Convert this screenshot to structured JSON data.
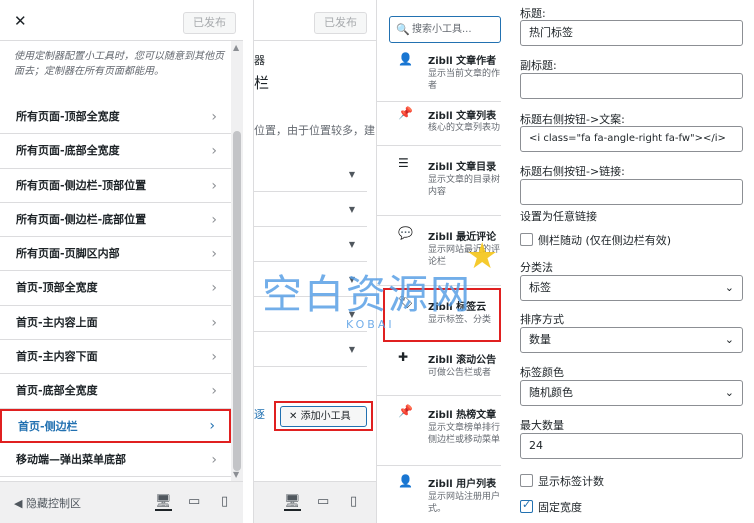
{
  "panel1": {
    "publish": "已发布",
    "description": "使用定制器配置小工具时，您可以随意到其他页面去；定制器在所有页面都能用。",
    "areas": [
      "所有页面-顶部全宽度",
      "所有页面-底部全宽度",
      "所有页面-侧边栏-顶部位置",
      "所有页面-侧边栏-底部位置",
      "所有页面-页脚区内部",
      "首页-顶部全宽度",
      "首页-主内容上面",
      "首页-主内容下面",
      "首页-底部全宽度",
      "首页-侧边栏",
      "移动端—弹出菜单底部"
    ],
    "footer": "隐藏控制区"
  },
  "panel2": {
    "publish": "已发布",
    "snip1": "器",
    "snip2": "栏",
    "snip3": "位置，由于位置较多，建",
    "snip4": "逐",
    "add": "添加小工具"
  },
  "panel3": {
    "search_placeholder": "搜索小工具...",
    "widgets": [
      {
        "t": "Zibll 文章作者",
        "d": "显示当前文章的作者"
      },
      {
        "t": "Zibll 文章列表",
        "d": "核心的文章列表功"
      },
      {
        "t": "Zibll 文章目录",
        "d": "显示文章的目录树内容"
      },
      {
        "t": "Zibll 最近评论",
        "d": "显示网站最近的评论栏"
      },
      {
        "t": "Zibll 标签云",
        "d": "显示标签、分类"
      },
      {
        "t": "Zibll 滚动公告",
        "d": "可做公告栏或者"
      },
      {
        "t": "Zibll 热榜文章",
        "d": "显示文章榜单排行侧边栏或移动菜单"
      },
      {
        "t": "Zibll 用户列表",
        "d": "显示网站注册用户式。"
      }
    ]
  },
  "panel4": {
    "title_label": "标题:",
    "title_value": "热门标签",
    "subtitle_label": "副标题:",
    "btn_text_label": "标题右侧按钮->文案:",
    "btn_text_value": "<i class=\"fa fa-angle-right fa-fw\"></i>",
    "btn_link_label": "标题右侧按钮->链接:",
    "any_link": "设置为任意链接",
    "follow_label": "侧栏随动 (仅在侧边栏有效)",
    "cat_label": "分类法",
    "cat_value": "标签",
    "order_label": "排序方式",
    "order_value": "数量",
    "color_label": "标签颜色",
    "color_value": "随机颜色",
    "max_label": "最大数量",
    "max_value": "24",
    "show_count": "显示标签计数",
    "fixed_width": "固定宽度"
  },
  "watermark": {
    "main": "空白资源网",
    "sub": "KOBAI"
  }
}
